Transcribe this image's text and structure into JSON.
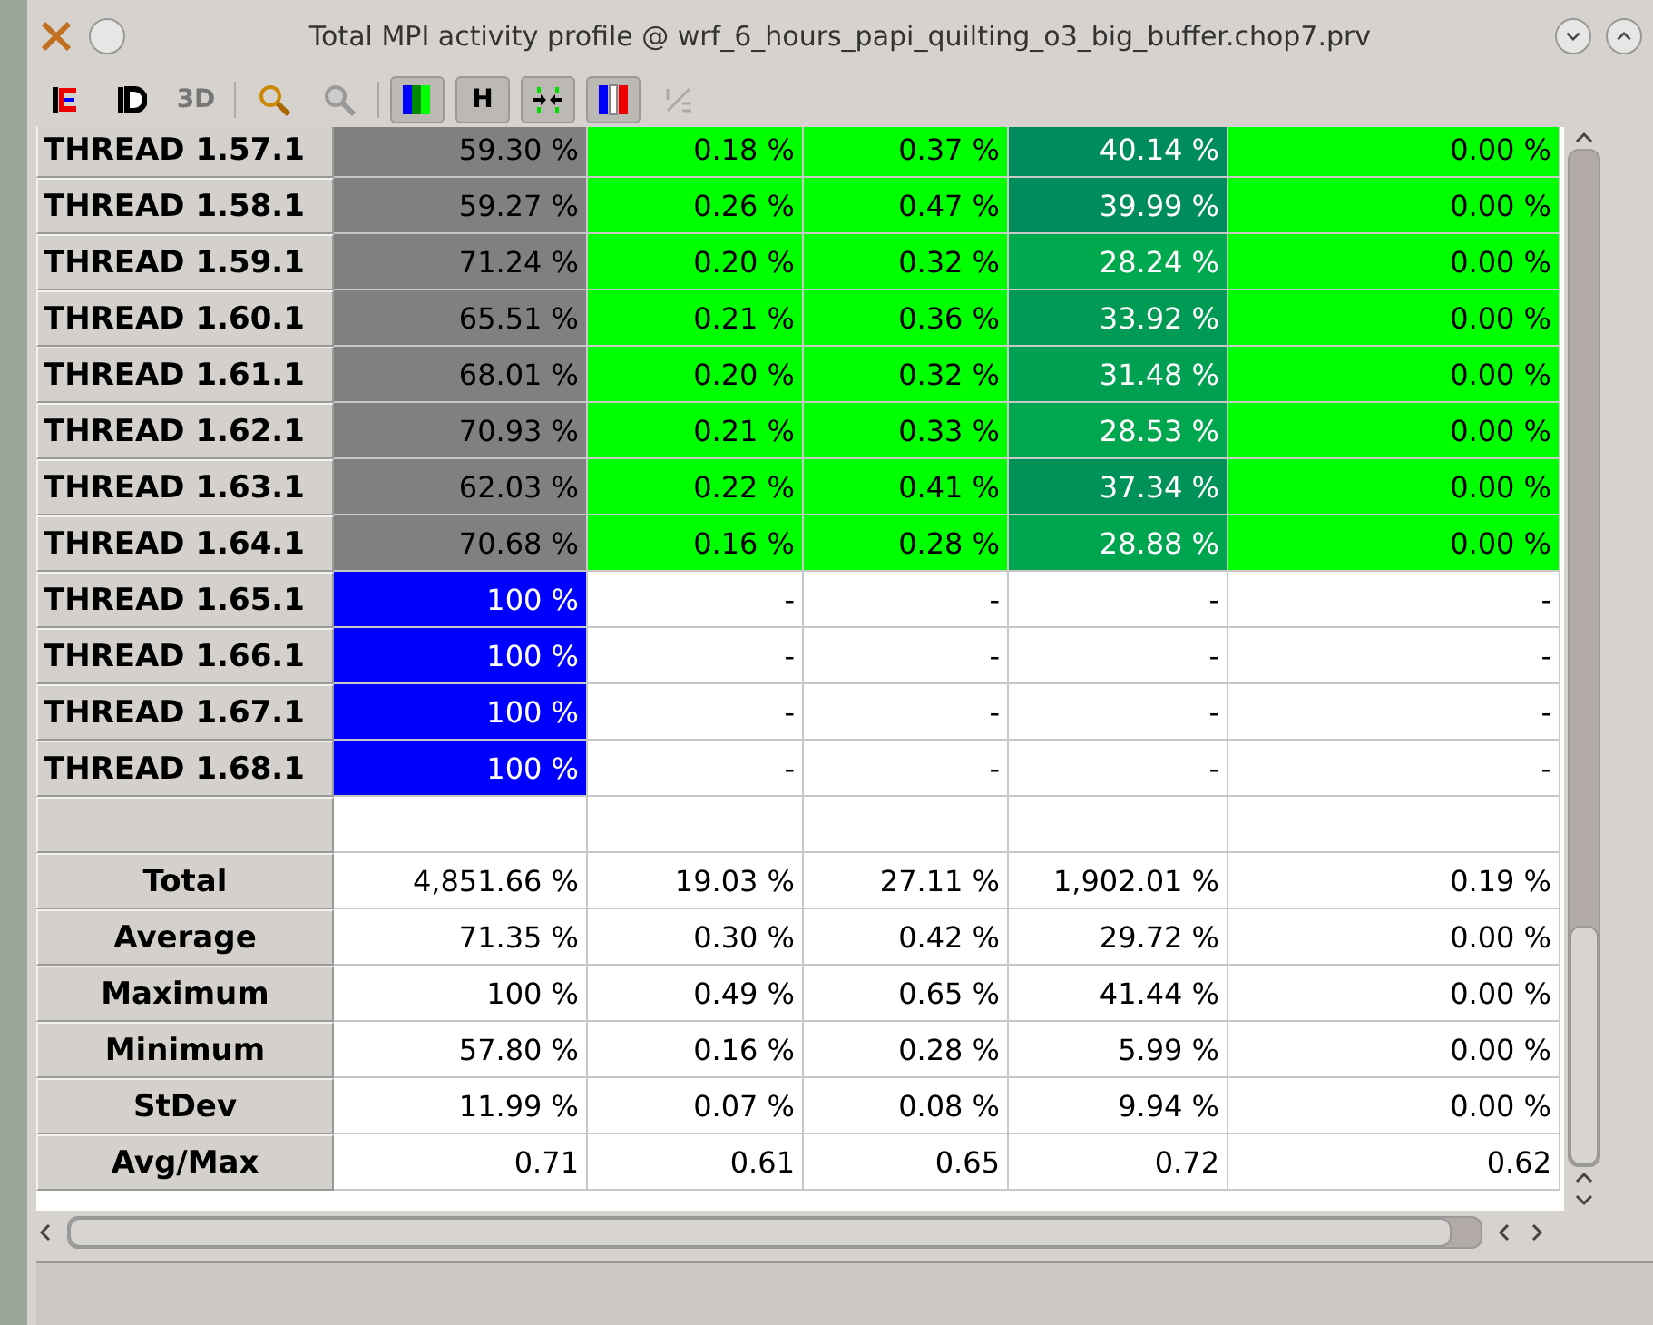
{
  "window": {
    "title": "Total MPI activity profile @ wrf_6_hours_papi_quilting_o3_big_buffer.chop7.prv"
  },
  "toolbar": [
    {
      "kind": "e-icon"
    },
    {
      "kind": "d-icon"
    },
    {
      "kind": "text",
      "label": "3D",
      "disabled": true
    },
    {
      "kind": "sep"
    },
    {
      "kind": "zoom-icon"
    },
    {
      "kind": "zoom-grey-icon"
    },
    {
      "kind": "sep"
    },
    {
      "kind": "bars-icon",
      "pressed": true
    },
    {
      "kind": "text",
      "label": "H",
      "pressed": true
    },
    {
      "kind": "arrows-icon",
      "pressed": true
    },
    {
      "kind": "redbars-icon",
      "pressed": true
    },
    {
      "kind": "fraction-icon"
    }
  ],
  "table": {
    "rows": [
      {
        "label": "THREAD 1.57.1",
        "cells": [
          {
            "text": "59.30 %",
            "color": "#808080"
          },
          {
            "text": "0.18 %",
            "color": "#00ff00"
          },
          {
            "text": "0.37 %",
            "color": "#00ff00"
          },
          {
            "text": "40.14 %",
            "color": "#008c5c"
          },
          {
            "text": "0.00 %",
            "color": "#00ff00"
          }
        ]
      },
      {
        "label": "THREAD 1.58.1",
        "cells": [
          {
            "text": "59.27 %",
            "color": "#808080"
          },
          {
            "text": "0.26 %",
            "color": "#00ff00"
          },
          {
            "text": "0.47 %",
            "color": "#00ff00"
          },
          {
            "text": "39.99 %",
            "color": "#008d5c"
          },
          {
            "text": "0.00 %",
            "color": "#00ff00"
          }
        ]
      },
      {
        "label": "THREAD 1.59.1",
        "cells": [
          {
            "text": "71.24 %",
            "color": "#808080"
          },
          {
            "text": "0.20 %",
            "color": "#00ff00"
          },
          {
            "text": "0.32 %",
            "color": "#00ff00"
          },
          {
            "text": "28.24 %",
            "color": "#00a84e"
          },
          {
            "text": "0.00 %",
            "color": "#00ff00"
          }
        ]
      },
      {
        "label": "THREAD 1.60.1",
        "cells": [
          {
            "text": "65.51 %",
            "color": "#808080"
          },
          {
            "text": "0.21 %",
            "color": "#00ff00"
          },
          {
            "text": "0.36 %",
            "color": "#00ff00"
          },
          {
            "text": "33.92 %",
            "color": "#009a55"
          },
          {
            "text": "0.00 %",
            "color": "#00ff00"
          }
        ]
      },
      {
        "label": "THREAD 1.61.1",
        "cells": [
          {
            "text": "68.01 %",
            "color": "#808080"
          },
          {
            "text": "0.20 %",
            "color": "#00ff00"
          },
          {
            "text": "0.32 %",
            "color": "#00ff00"
          },
          {
            "text": "31.48 %",
            "color": "#00a052"
          },
          {
            "text": "0.00 %",
            "color": "#00ff00"
          }
        ]
      },
      {
        "label": "THREAD 1.62.1",
        "cells": [
          {
            "text": "70.93 %",
            "color": "#808080"
          },
          {
            "text": "0.21 %",
            "color": "#00ff00"
          },
          {
            "text": "0.33 %",
            "color": "#00ff00"
          },
          {
            "text": "28.53 %",
            "color": "#00a74e"
          },
          {
            "text": "0.00 %",
            "color": "#00ff00"
          }
        ]
      },
      {
        "label": "THREAD 1.63.1",
        "cells": [
          {
            "text": "62.03 %",
            "color": "#808080"
          },
          {
            "text": "0.22 %",
            "color": "#00ff00"
          },
          {
            "text": "0.41 %",
            "color": "#00ff00"
          },
          {
            "text": "37.34 %",
            "color": "#009258"
          },
          {
            "text": "0.00 %",
            "color": "#00ff00"
          }
        ]
      },
      {
        "label": "THREAD 1.64.1",
        "cells": [
          {
            "text": "70.68 %",
            "color": "#808080"
          },
          {
            "text": "0.16 %",
            "color": "#00ff00"
          },
          {
            "text": "0.28 %",
            "color": "#00ff00"
          },
          {
            "text": "28.88 %",
            "color": "#00a64f"
          },
          {
            "text": "0.00 %",
            "color": "#00ff00"
          }
        ]
      },
      {
        "label": "THREAD 1.65.1",
        "cells": [
          {
            "text": "100 %",
            "color": "#0000ff"
          },
          {
            "text": "-",
            "color": "#ffffff"
          },
          {
            "text": "-",
            "color": "#ffffff"
          },
          {
            "text": "-",
            "color": "#ffffff"
          },
          {
            "text": "-",
            "color": "#ffffff"
          }
        ]
      },
      {
        "label": "THREAD 1.66.1",
        "cells": [
          {
            "text": "100 %",
            "color": "#0000ff"
          },
          {
            "text": "-",
            "color": "#ffffff"
          },
          {
            "text": "-",
            "color": "#ffffff"
          },
          {
            "text": "-",
            "color": "#ffffff"
          },
          {
            "text": "-",
            "color": "#ffffff"
          }
        ]
      },
      {
        "label": "THREAD 1.67.1",
        "cells": [
          {
            "text": "100 %",
            "color": "#0000ff"
          },
          {
            "text": "-",
            "color": "#ffffff"
          },
          {
            "text": "-",
            "color": "#ffffff"
          },
          {
            "text": "-",
            "color": "#ffffff"
          },
          {
            "text": "-",
            "color": "#ffffff"
          }
        ]
      },
      {
        "label": "THREAD 1.68.1",
        "cells": [
          {
            "text": "100 %",
            "color": "#0000ff"
          },
          {
            "text": "-",
            "color": "#ffffff"
          },
          {
            "text": "-",
            "color": "#ffffff"
          },
          {
            "text": "-",
            "color": "#ffffff"
          },
          {
            "text": "-",
            "color": "#ffffff"
          }
        ]
      },
      {
        "kind": "blank",
        "cells": []
      },
      {
        "kind": "stat",
        "label": "Total",
        "cells": [
          {
            "text": "4,851.66 %"
          },
          {
            "text": "19.03 %"
          },
          {
            "text": "27.11 %"
          },
          {
            "text": "1,902.01 %"
          },
          {
            "text": "0.19 %"
          }
        ]
      },
      {
        "kind": "stat",
        "label": "Average",
        "cells": [
          {
            "text": "71.35 %"
          },
          {
            "text": "0.30 %"
          },
          {
            "text": "0.42 %"
          },
          {
            "text": "29.72 %"
          },
          {
            "text": "0.00 %"
          }
        ]
      },
      {
        "kind": "stat",
        "label": "Maximum",
        "cells": [
          {
            "text": "100 %"
          },
          {
            "text": "0.49 %"
          },
          {
            "text": "0.65 %"
          },
          {
            "text": "41.44 %"
          },
          {
            "text": "0.00 %"
          }
        ]
      },
      {
        "kind": "stat",
        "label": "Minimum",
        "cells": [
          {
            "text": "57.80 %"
          },
          {
            "text": "0.16 %"
          },
          {
            "text": "0.28 %"
          },
          {
            "text": "5.99 %"
          },
          {
            "text": "0.00 %"
          }
        ]
      },
      {
        "kind": "stat",
        "label": "StDev",
        "cells": [
          {
            "text": "11.99 %"
          },
          {
            "text": "0.07 %"
          },
          {
            "text": "0.08 %"
          },
          {
            "text": "9.94 %"
          },
          {
            "text": "0.00 %"
          }
        ]
      },
      {
        "kind": "stat",
        "label": "Avg/Max",
        "cells": [
          {
            "text": "0.71"
          },
          {
            "text": "0.61"
          },
          {
            "text": "0.65"
          },
          {
            "text": "0.72"
          },
          {
            "text": "0.62"
          }
        ]
      }
    ]
  }
}
